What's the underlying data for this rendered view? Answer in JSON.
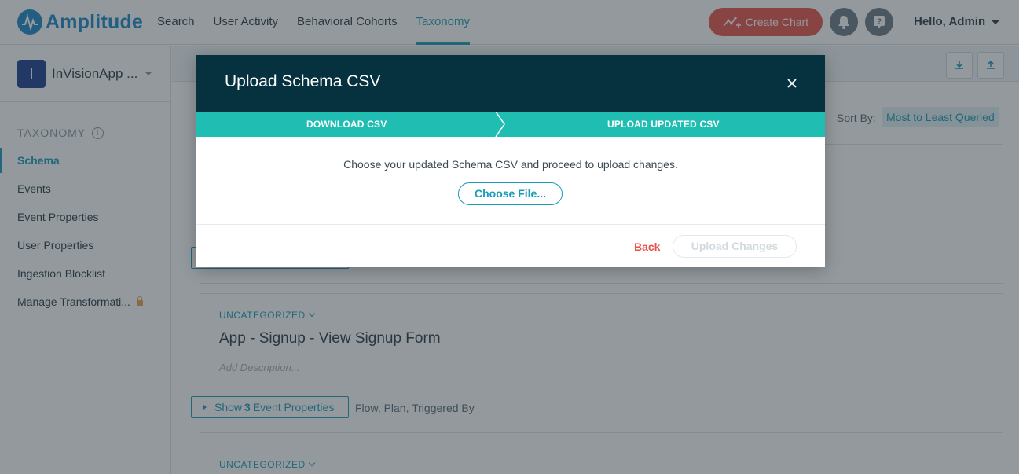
{
  "app": {
    "logo_text": "Amplitude",
    "brand_color": "#1e88c8",
    "accent_color": "#1a9cb8"
  },
  "nav": {
    "items": [
      {
        "label": "Search"
      },
      {
        "label": "User Activity"
      },
      {
        "label": "Behavioral Cohorts"
      },
      {
        "label": "Taxonomy"
      }
    ],
    "active": "Taxonomy",
    "create_chart": "Create Chart",
    "greeting": "Hello, Admin"
  },
  "sidebar": {
    "project_initial": "I",
    "project_name": "InVisionApp ...",
    "section_heading": "TAXONOMY",
    "items": [
      {
        "label": "Schema",
        "active": true
      },
      {
        "label": "Events"
      },
      {
        "label": "Event Properties"
      },
      {
        "label": "User Properties"
      },
      {
        "label": "Ingestion Blocklist"
      },
      {
        "label": "Manage Transformati...",
        "locked": true
      }
    ]
  },
  "main": {
    "sort_label": "Sort By:",
    "sort_value": "Most to Least Queried",
    "cards": [
      {
        "category": "UNCATEGORIZED",
        "title": "App - Signup - View Signup Form",
        "description_placeholder": "Add Description...",
        "props_button": {
          "prefix": "Show ",
          "count": "3",
          "suffix": " Event Properties"
        },
        "props_list": "Flow, Plan, Triggered By"
      },
      {
        "category": "UNCATEGORIZED"
      }
    ]
  },
  "modal": {
    "title": "Upload Schema CSV",
    "steps": [
      {
        "label": "DOWNLOAD CSV"
      },
      {
        "label": "UPLOAD UPDATED CSV"
      }
    ],
    "instructions": "Choose your updated Schema CSV and proceed to upload changes.",
    "choose_file": "Choose File...",
    "back": "Back",
    "upload": "Upload Changes"
  }
}
